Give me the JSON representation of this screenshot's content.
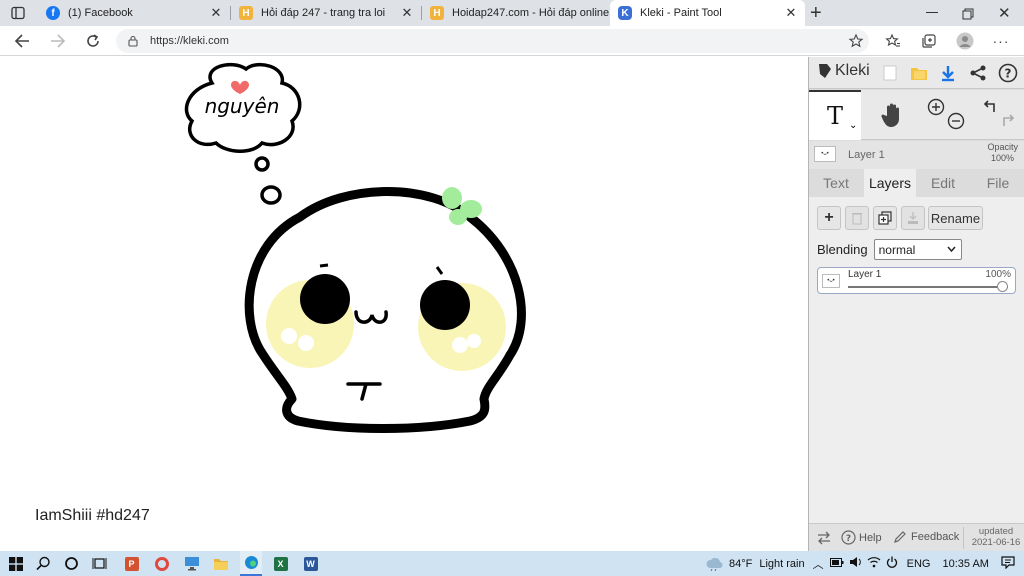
{
  "browser": {
    "tabs": [
      {
        "title": "(1) Facebook",
        "icon": "facebook-icon"
      },
      {
        "title": "Hỏi đáp 247 - trang tra loi",
        "icon": "hoidap-icon"
      },
      {
        "title": "Hoidap247.com - Hỏi đáp online",
        "icon": "hoidap-icon"
      },
      {
        "title": "Kleki - Paint Tool",
        "icon": "kleki-icon"
      }
    ],
    "url": "https://kleki.com",
    "new_tab": "+"
  },
  "canvas": {
    "bubble_text": "nguyên",
    "signature": "IamShiii #hd247",
    "colors": {
      "outline": "#000000",
      "cheek": "#f9f5b6",
      "leaf": "#a3ec9c",
      "heart": "#f06a6a"
    }
  },
  "kleki": {
    "brand": "Kleki",
    "current_tool": "T",
    "layer_name": "Layer 1",
    "opacity_label": "Opacity",
    "opacity_value": "100%",
    "tabs": [
      "Text",
      "Layers",
      "Edit",
      "File"
    ],
    "active_tab": "Layers",
    "rename_label": "Rename",
    "blending_label": "Blending",
    "blending_value": "normal",
    "layer_item": {
      "name": "Layer 1",
      "opacity": "100%",
      "opacity_fraction": 1.0
    },
    "help_label": "Help",
    "feedback_label": "Feedback",
    "updated_label": "updated",
    "updated_date": "2021-06-16"
  },
  "taskbar": {
    "weather_temp": "84°F",
    "weather_desc": "Light rain",
    "language": "ENG",
    "time": "10:35 AM"
  }
}
